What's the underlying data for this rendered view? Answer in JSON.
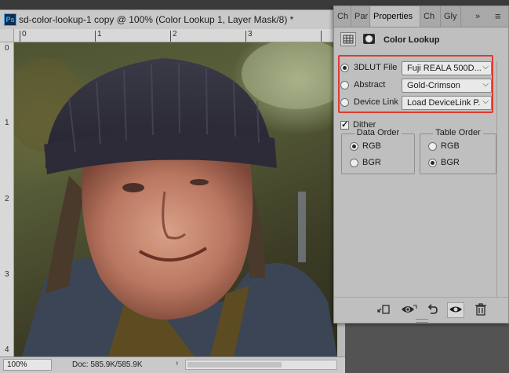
{
  "document": {
    "app_icon": "Ps",
    "title": "sd-color-lookup-1 copy @ 100% (Color Lookup 1, Layer Mask/8) *",
    "ruler_top": [
      "0",
      "1",
      "2",
      "3"
    ],
    "ruler_left": [
      "0",
      "1",
      "2",
      "3",
      "4"
    ],
    "zoom": "100%",
    "doc_size": "Doc: 585.9K/585.9K",
    "status_arrow": "›"
  },
  "panel": {
    "tabs": [
      "Ch",
      "Par",
      "Properties",
      "Ch",
      "Gly"
    ],
    "tab_overflow": "»",
    "menu_icon": "≡",
    "title": "Color Lookup",
    "rows": [
      {
        "label": "3DLUT File",
        "value": "Fuji REALA 500D...",
        "checked": true
      },
      {
        "label": "Abstract",
        "value": "Gold-Crimson",
        "checked": false
      },
      {
        "label": "Device Link",
        "value": "Load DeviceLink P...",
        "checked": false
      }
    ],
    "dither": {
      "label": "Dither",
      "checked": true
    },
    "data_order": {
      "title": "Data Order",
      "options": [
        "RGB",
        "BGR"
      ],
      "selected": "RGB"
    },
    "table_order": {
      "title": "Table Order",
      "options": [
        "RGB",
        "BGR"
      ],
      "selected": "BGR"
    },
    "bottom_icons": [
      "clip-to-layer-icon",
      "view-previous-state-icon",
      "reset-icon",
      "visibility-icon",
      "delete-icon"
    ]
  },
  "colors": {
    "highlight": "#e03a32",
    "panel_bg": "#bfbfbf",
    "workspace_bg": "#535353"
  }
}
